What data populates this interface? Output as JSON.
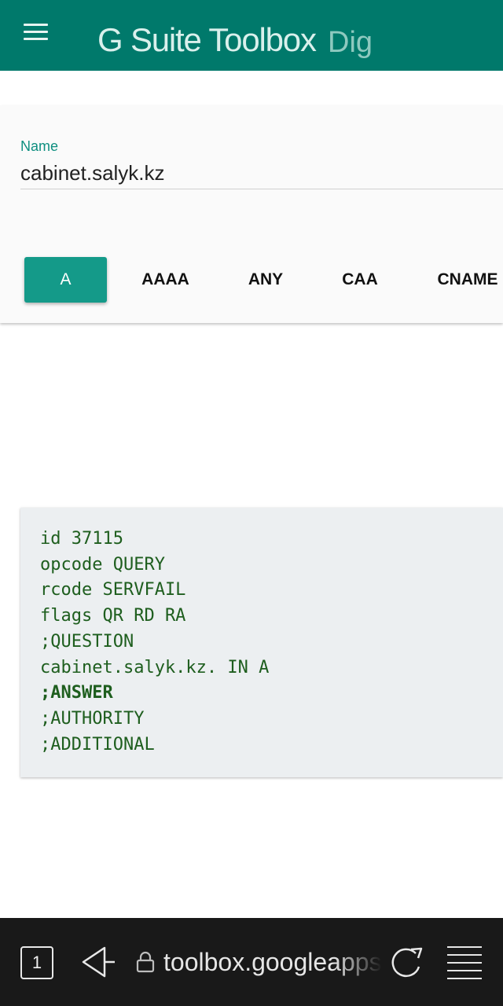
{
  "appbar": {
    "title": "G Suite Toolbox",
    "subtitle": "Dig",
    "color": "#00796b"
  },
  "form": {
    "name_label": "Name",
    "name_value": "cabinet.salyk.kz"
  },
  "record_tabs": {
    "items": [
      "A",
      "AAAA",
      "ANY",
      "CAA",
      "CNAME"
    ],
    "selected": "A"
  },
  "result": {
    "lines": [
      "id 37115",
      "opcode QUERY",
      "rcode SERVFAIL",
      "flags QR RD RA",
      ";QUESTION",
      "cabinet.salyk.kz. IN A",
      ";ANSWER",
      ";AUTHORITY",
      ";ADDITIONAL"
    ]
  },
  "browser": {
    "tab_count": "1",
    "url": "toolbox.googleapps.com/apps/dig",
    "icons": [
      "tab-switcher-icon",
      "back-icon",
      "lock-icon",
      "reload-icon",
      "menu-icon"
    ]
  }
}
